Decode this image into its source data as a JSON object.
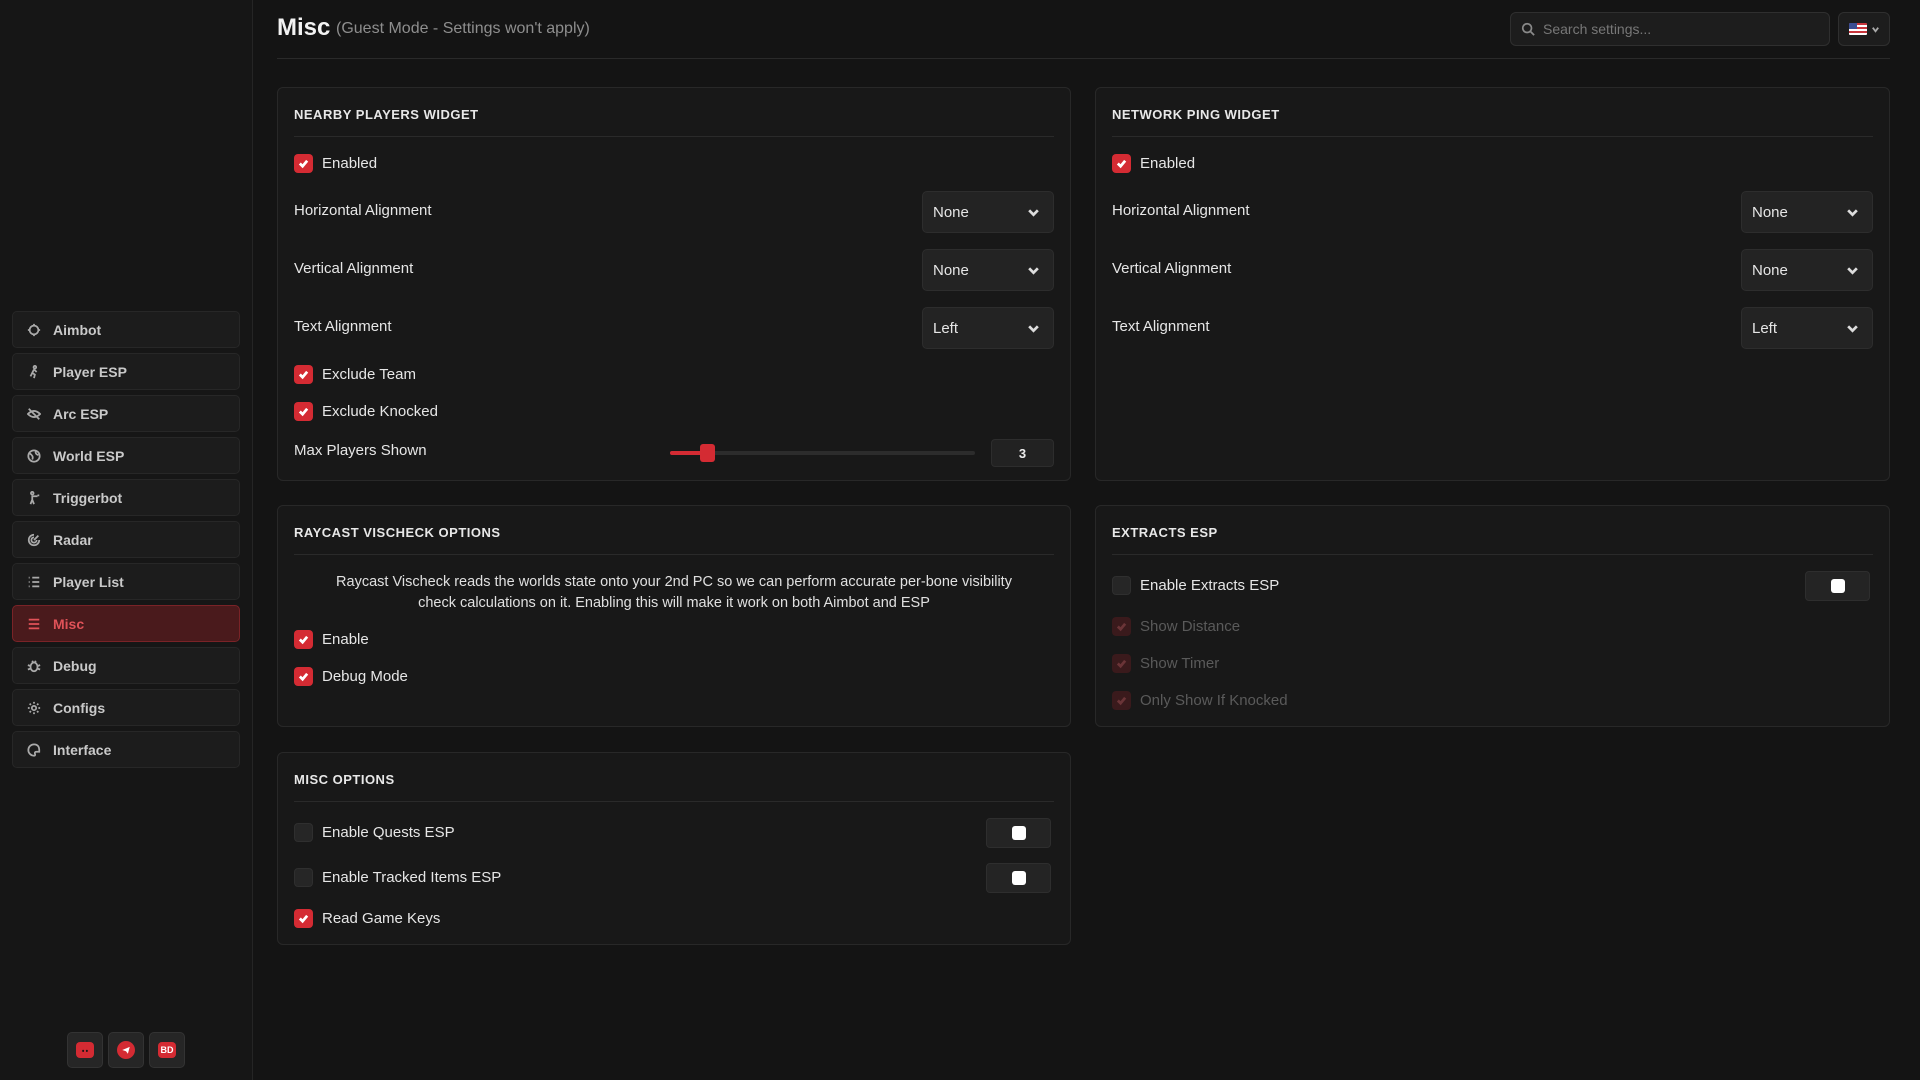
{
  "header": {
    "title": "Misc",
    "subtitle": "(Guest Mode - Settings won't apply)",
    "search_placeholder": "Search settings..."
  },
  "sidebar": {
    "items": [
      {
        "label": "Aimbot",
        "icon": "crosshair-icon"
      },
      {
        "label": "Player ESP",
        "icon": "running-person-icon"
      },
      {
        "label": "Arc ESP",
        "icon": "eye-slash-icon"
      },
      {
        "label": "World ESP",
        "icon": "globe-icon"
      },
      {
        "label": "Triggerbot",
        "icon": "person-shooting-icon"
      },
      {
        "label": "Radar",
        "icon": "radar-icon"
      },
      {
        "label": "Player List",
        "icon": "list-icon"
      },
      {
        "label": "Misc",
        "icon": "menu-icon",
        "active": true
      },
      {
        "label": "Debug",
        "icon": "bug-icon"
      },
      {
        "label": "Configs",
        "icon": "gear-icon"
      },
      {
        "label": "Interface",
        "icon": "palette-icon"
      }
    ],
    "socials": [
      "discord-icon",
      "telegram-icon",
      "bd-icon"
    ],
    "bd_label": "BD"
  },
  "nearby": {
    "title": "NEARBY PLAYERS WIDGET",
    "enabled_label": "Enabled",
    "horizontal_label": "Horizontal Alignment",
    "horizontal_value": "None",
    "vertical_label": "Vertical Alignment",
    "vertical_value": "None",
    "text_label": "Text Alignment",
    "text_value": "Left",
    "exclude_team_label": "Exclude Team",
    "exclude_knocked_label": "Exclude Knocked",
    "max_players_label": "Max Players Shown",
    "max_players_value": "3",
    "max_players_fraction": 0.12
  },
  "ping": {
    "title": "NETWORK PING WIDGET",
    "enabled_label": "Enabled",
    "horizontal_label": "Horizontal Alignment",
    "horizontal_value": "None",
    "vertical_label": "Vertical Alignment",
    "vertical_value": "None",
    "text_label": "Text Alignment",
    "text_value": "Left"
  },
  "raycast": {
    "title": "RAYCAST VISCHECK OPTIONS",
    "description_1": "Raycast Vischeck reads the worlds state onto your 2nd PC so we can perform accurate per-bone visibility",
    "description_2": "check calculations on it. Enabling this will make it work on both Aimbot and ESP",
    "enable_label": "Enable",
    "debug_label": "Debug Mode"
  },
  "extracts": {
    "title": "EXTRACTS ESP",
    "enable_label": "Enable Extracts ESP",
    "distance_label": "Show Distance",
    "timer_label": "Show Timer",
    "knocked_label": "Only Show If Knocked",
    "color": "#ffffff"
  },
  "misc": {
    "title": "MISC OPTIONS",
    "quests_label": "Enable Quests ESP",
    "tracked_label": "Enable Tracked Items ESP",
    "gamekeys_label": "Read Game Keys",
    "quests_color": "#ffffff",
    "tracked_color": "#ffffff"
  },
  "colors": {
    "accent": "#d42b33",
    "background": "#141414",
    "panel": "#181818"
  }
}
